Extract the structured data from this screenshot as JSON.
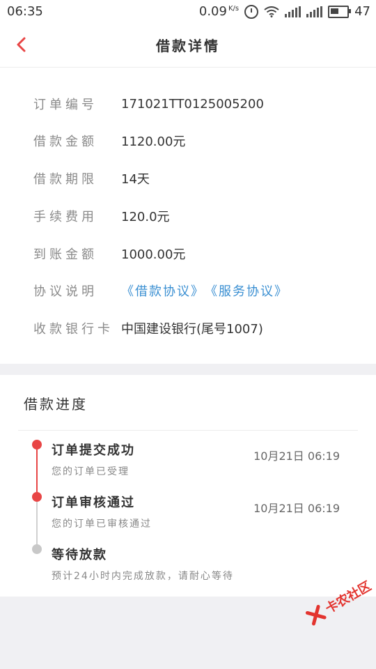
{
  "status_bar": {
    "time": "06:35",
    "speed": "0.09",
    "speed_unit": "K/s",
    "battery": "47"
  },
  "nav": {
    "title": "借款详情"
  },
  "details": [
    {
      "label": "订单编号",
      "value": "171021TT0125005200"
    },
    {
      "label": "借款金额",
      "value": "1120.00元"
    },
    {
      "label": "借款期限",
      "value": "14天"
    },
    {
      "label": "手续费用",
      "value": "120.0元"
    },
    {
      "label": "到账金额",
      "value": "1000.00元"
    },
    {
      "label": "协议说明",
      "links": [
        "《借款协议》",
        "《服务协议》"
      ]
    },
    {
      "label": "收款银行卡",
      "value": "中国建设银行(尾号1007)"
    }
  ],
  "progress": {
    "title": "借款进度",
    "steps": [
      {
        "title": "订单提交成功",
        "subtitle": "您的订单已受理",
        "time": "10月21日 06:19",
        "status": "done"
      },
      {
        "title": "订单审核通过",
        "subtitle": "您的订单已审核通过",
        "time": "10月21日 06:19",
        "status": "done"
      },
      {
        "title": "等待放款",
        "subtitle": "预计24小时内完成放款，请耐心等待",
        "status": "pending"
      }
    ]
  },
  "colors": {
    "accent_red": "#e84545",
    "link_blue": "#3a8fd2",
    "pending_gray": "#c8c8c8"
  },
  "watermark": {
    "text": "卡农社区"
  }
}
